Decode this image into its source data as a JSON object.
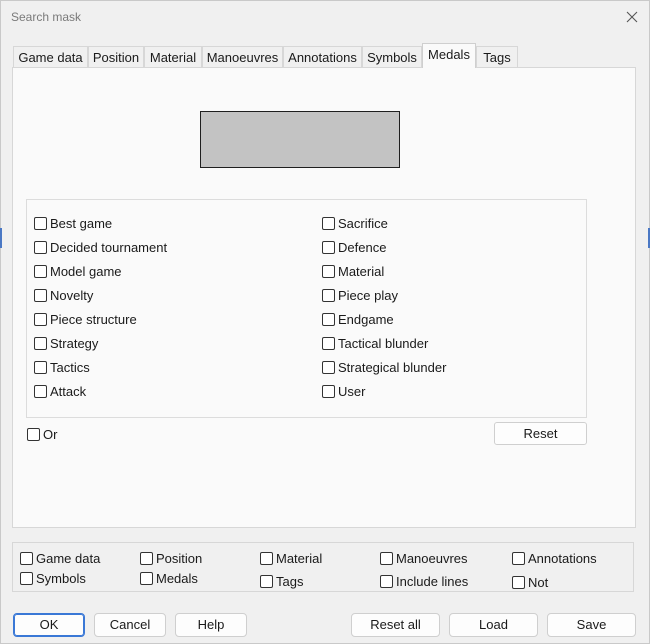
{
  "window": {
    "title": "Search mask"
  },
  "tabs": [
    {
      "label": "Game data"
    },
    {
      "label": "Position"
    },
    {
      "label": "Material"
    },
    {
      "label": "Manoeuvres"
    },
    {
      "label": "Annotations"
    },
    {
      "label": "Symbols"
    },
    {
      "label": "Medals",
      "active": true
    },
    {
      "label": "Tags"
    }
  ],
  "medals": {
    "left": [
      {
        "label": "Best game",
        "checked": false
      },
      {
        "label": "Decided tournament",
        "checked": false
      },
      {
        "label": "Model game",
        "checked": false
      },
      {
        "label": "Novelty",
        "checked": false
      },
      {
        "label": "Piece structure",
        "checked": false
      },
      {
        "label": "Strategy",
        "checked": false
      },
      {
        "label": "Tactics",
        "checked": false
      },
      {
        "label": "Attack",
        "checked": false
      }
    ],
    "right": [
      {
        "label": "Sacrifice",
        "checked": false
      },
      {
        "label": "Defence",
        "checked": false
      },
      {
        "label": "Material",
        "checked": false
      },
      {
        "label": "Piece play",
        "checked": false
      },
      {
        "label": "Endgame",
        "checked": false
      },
      {
        "label": "Tactical blunder",
        "checked": false
      },
      {
        "label": "Strategical blunder",
        "checked": false
      },
      {
        "label": "User",
        "checked": false
      }
    ],
    "or_label": "Or",
    "reset_label": "Reset"
  },
  "filters": {
    "row1": [
      "Game data",
      "Position",
      "Material",
      "Manoeuvres",
      "Annotations"
    ],
    "row2": [
      "Symbols",
      "Medals",
      "Tags",
      "Include lines",
      "Not"
    ]
  },
  "buttons": {
    "ok": "OK",
    "cancel": "Cancel",
    "help": "Help",
    "reset_all": "Reset all",
    "load": "Load",
    "save": "Save"
  }
}
